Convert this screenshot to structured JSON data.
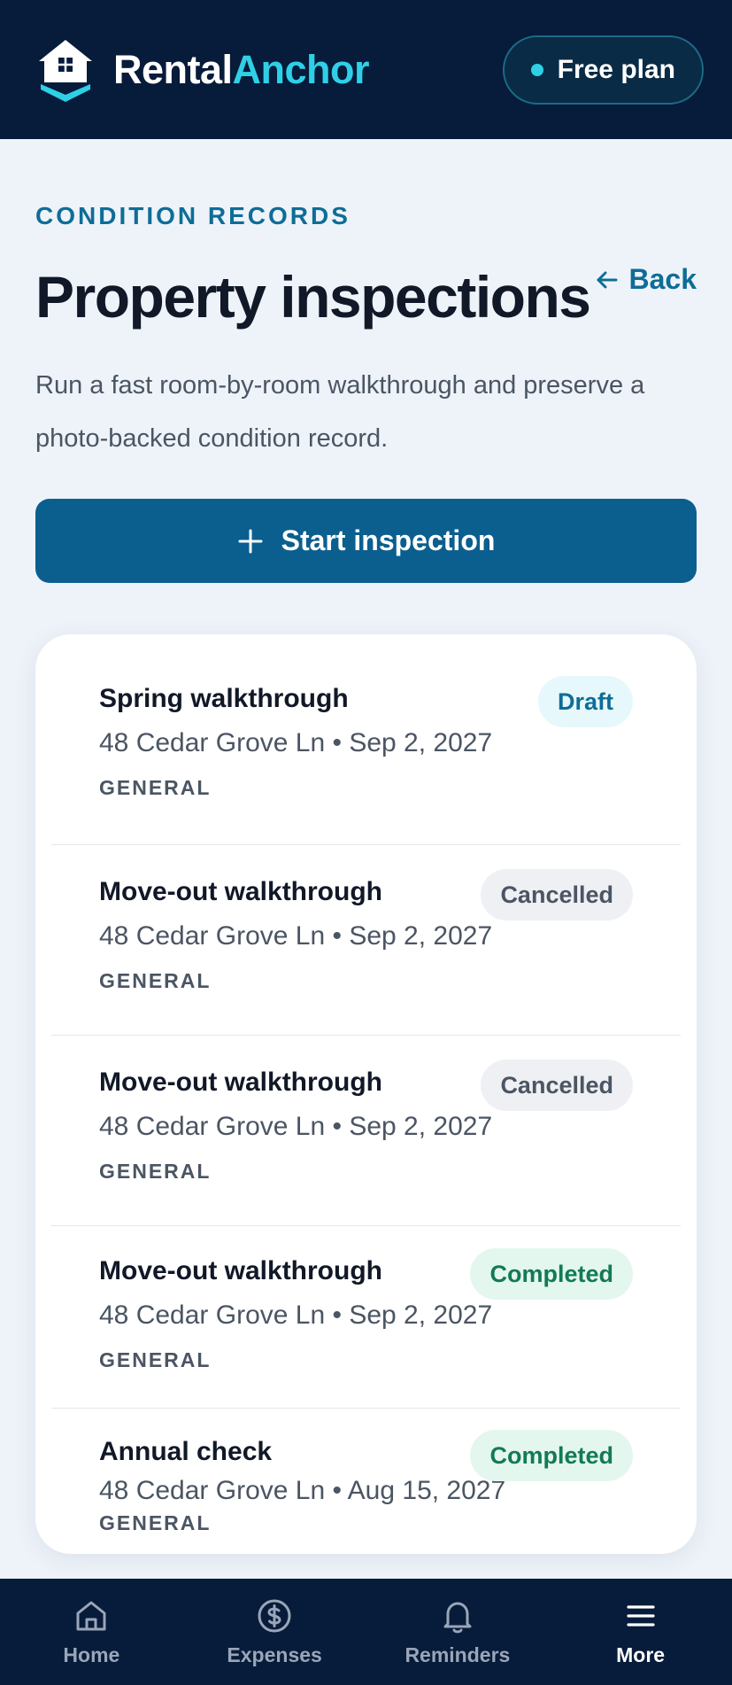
{
  "header": {
    "brand_prefix": "Rental",
    "brand_accent": "Anchor",
    "plan_label": "Free plan"
  },
  "page": {
    "eyebrow": "CONDITION RECORDS",
    "title": "Property inspections",
    "back_label": "Back",
    "subtitle": "Run a fast room-by-room walkthrough and preserve a photo-backed condition record.",
    "start_button": "Start inspection"
  },
  "inspections": [
    {
      "title": "Spring walkthrough",
      "meta": "48 Cedar Grove Ln • Sep 2, 2027",
      "tag": "GENERAL",
      "status": "Draft"
    },
    {
      "title": "Move-out walkthrough",
      "meta": "48 Cedar Grove Ln • Sep 2, 2027",
      "tag": "GENERAL",
      "status": "Cancelled"
    },
    {
      "title": "Move-out walkthrough",
      "meta": "48 Cedar Grove Ln • Sep 2, 2027",
      "tag": "GENERAL",
      "status": "Cancelled"
    },
    {
      "title": "Move-out walkthrough",
      "meta": "48 Cedar Grove Ln • Sep 2, 2027",
      "tag": "GENERAL",
      "status": "Completed"
    },
    {
      "title": "Annual check",
      "meta": "48 Cedar Grove Ln • Aug 15, 2027",
      "tag": "GENERAL",
      "status": "Completed"
    }
  ],
  "nav": {
    "home": "Home",
    "expenses": "Expenses",
    "reminders": "Reminders",
    "more": "More",
    "active": "more"
  },
  "colors": {
    "header_bg": "#071b3a",
    "accent": "#2fd0e6",
    "primary": "#0b5f8f",
    "draft": "#0e6d97",
    "completed": "#137a55"
  },
  "icons": [
    "house-logo-icon",
    "arrow-left-icon",
    "plus-icon",
    "home-icon",
    "dollar-circle-icon",
    "bell-icon",
    "menu-icon"
  ]
}
